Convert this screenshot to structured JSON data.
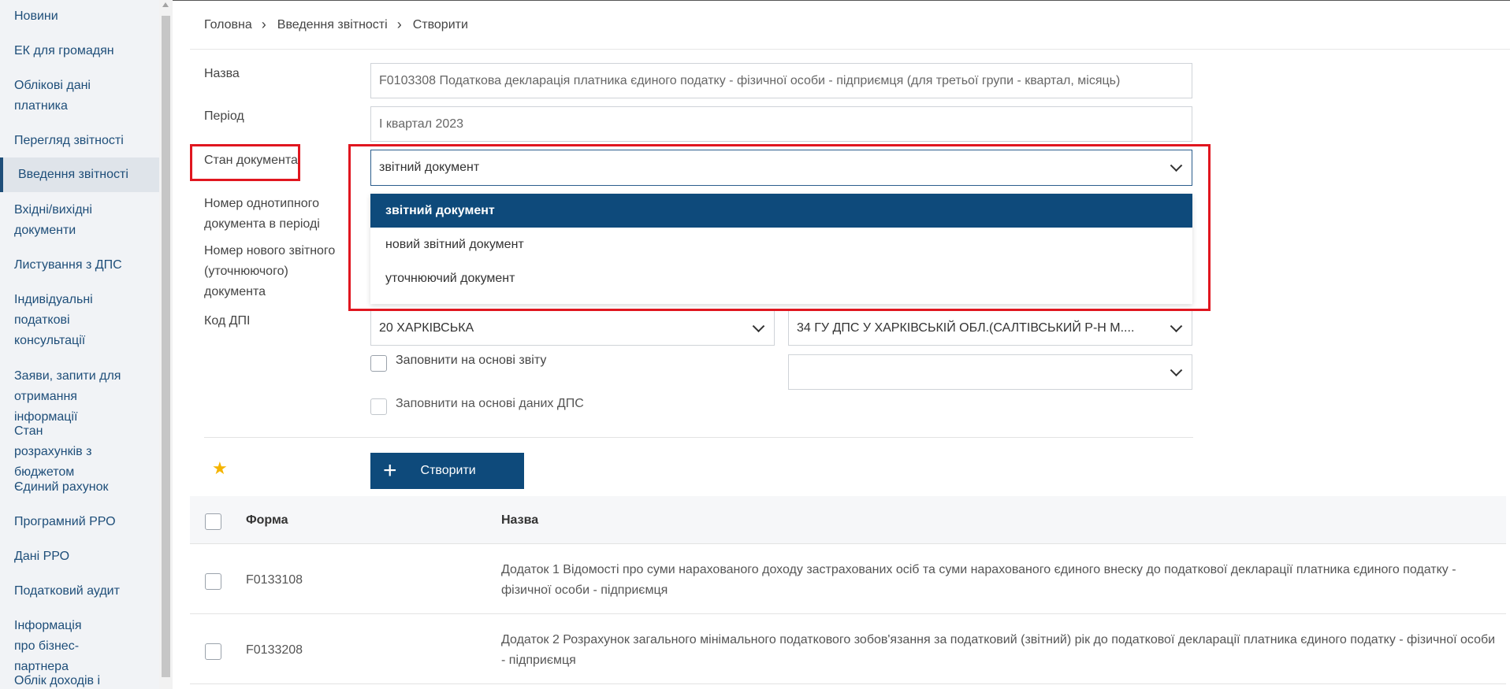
{
  "sidebar": {
    "items": [
      "Новини",
      "ЕК для громадян",
      "Облікові дані платника",
      "Перегляд звітності",
      "Введення звітності",
      "Вхідні/вихідні документи",
      "Листування з ДПС",
      "Індивідуальні податкові консультації",
      "Заяви, запити для отримання інформації",
      "Стан розрахунків з бюджетом",
      "Єдиний рахунок",
      "Програмний РРО",
      "Дані РРО",
      "Податковий аудит",
      "Інформація про бізнес-партнера",
      "Облік доходів і"
    ],
    "active_index": 4
  },
  "breadcrumb": [
    "Головна",
    "Введення звітності",
    "Створити"
  ],
  "form": {
    "name_label": "Назва",
    "name_value": "F0103308 Податкова декларація платника єдиного податку - фізичної особи - підприємця (для третьої групи - квартал, місяць)",
    "period_label": "Період",
    "period_value": "I квартал 2023",
    "status_label": "Стан документа",
    "status_value": "звітний документ",
    "status_options": [
      "звітний документ",
      "новий звітний документ",
      "уточнюючий документ"
    ],
    "same_type_label": "Номер однотипного документа в періоді",
    "new_report_label": "Номер нового звітного (уточнюючого) документа",
    "dpi_label": "Код ДПІ",
    "region_value": "20 ХАРКІВСЬКА",
    "office_value": "34 ГУ ДПС У ХАРКІВСЬКІЙ ОБЛ.(САЛТІВСЬКИЙ Р-Н М....",
    "third_select_value": "",
    "fill_from_report_label": "Заповнити на основі звіту",
    "fill_from_dps_label": "Заповнити на основі даних ДПС",
    "create_button": "Створити"
  },
  "table": {
    "columns": [
      "Форма",
      "Назва"
    ],
    "rows": [
      {
        "form": "F0133108",
        "name": "Додаток 1 Відомості про суми нарахованого доходу застрахованих осіб та суми нарахованого єдиного внеску до податкової декларації платника єдиного податку - фізичної особи - підприємця"
      },
      {
        "form": "F0133208",
        "name": "Додаток 2 Розрахунок загального мінімального податкового зобов'язання за податковий (звітний) рік до податкової декларації платника єдиного податку - фізичної особи - підприємця"
      }
    ]
  },
  "colors": {
    "accent": "#0e4a7b",
    "highlight": "#e0161f",
    "star": "#f5b400"
  }
}
